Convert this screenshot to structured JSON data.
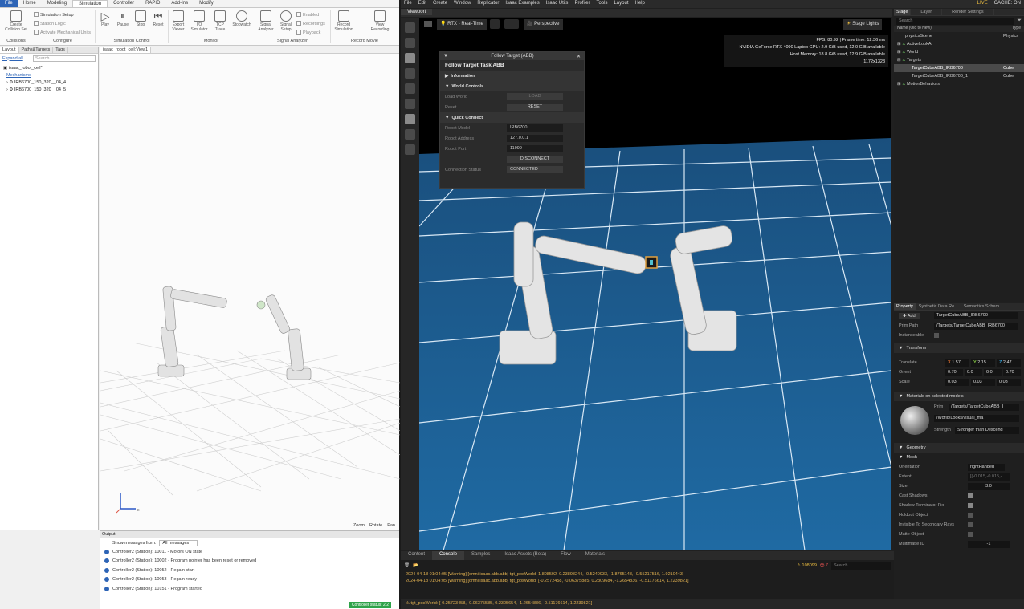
{
  "rs": {
    "menu": [
      "File",
      "Home",
      "Modeling",
      "Simulation",
      "Controller",
      "RAPID",
      "Add-Ins",
      "Modify"
    ],
    "ribbon": {
      "create_collision_set": "Create Collision Set",
      "setup_simulation": "Simulation Setup",
      "station_logic": "Station Logic",
      "activate_mech": "Activate Mechanical Units",
      "play": "Play",
      "pause": "Pause",
      "stop": "Stop",
      "reset": "Reset",
      "export_viewer": "Export Viewer",
      "io_simulator": "I/O Simulator",
      "tcp_trace": "TCP Trace",
      "stopwatch": "Stopwatch",
      "signal_analyzer": "Signal Analyzer",
      "signal_setup": "Signal Setup",
      "enabled": "Enabled",
      "recordings": "Recordings",
      "playback": "Playback",
      "record_sim": "Record Simulation",
      "view_recording": "View Recording",
      "groups": [
        "Collisions",
        "Configure",
        "Simulation Control",
        "Monitor",
        "Signal Analyzer",
        "Record Movie"
      ]
    },
    "left_tabs": [
      "Layout",
      "Paths&Targets",
      "Tags"
    ],
    "expand_all": "Expand all",
    "search_placeholder": "Search",
    "tree": {
      "station": "isaac_robot_cell*",
      "mechanisms": "Mechanisms",
      "robots": [
        "IRB6700_150_320__04_4",
        "IRB6700_150_320__04_5"
      ]
    },
    "view_tab": "isaac_robot_cell:View1",
    "view_status": [
      "Zoom",
      "Rotate",
      "Pan"
    ],
    "output": {
      "title": "Output",
      "show_label": "Show messages from:",
      "filter": "All messages",
      "messages": [
        "Controller2 (Station): 10011 - Motors ON state",
        "Controller2 (Station): 10002 - Program pointer has been reset or removed",
        "Controller2 (Station): 10052 - Regain start",
        "Controller2 (Station): 10053 - Regain ready",
        "Controller2 (Station): 10151 - Program started"
      ],
      "status": "Controller status: 2/2"
    }
  },
  "isaac": {
    "menu": [
      "File",
      "Edit",
      "Create",
      "Window",
      "Replicator",
      "Isaac Examples",
      "Isaac Utils",
      "Profiler",
      "Tools",
      "Layout",
      "Help"
    ],
    "live": "LIVE",
    "cache": "CACHE: ON",
    "viewport_tab": "Viewport",
    "render_mode": "RTX - Real-Time",
    "camera": "Perspective",
    "stage_lights": "Stage Lights",
    "stats": [
      "FPS: 80.92 | Frame time: 12.36 ms",
      "NVIDIA GeForce RTX 4090 Laptop GPU: 2.9 GiB used, 12.0 GiB available",
      "Host Memory: 18.8 GiB used, 12.9 GiB available",
      "1172x1323"
    ],
    "follow_target": {
      "title": "Follow Target (ABB)",
      "task": "Follow Target Task ABB",
      "information": "Information",
      "world_controls": "World Controls",
      "load_world": "Load World",
      "load_btn": "LOAD",
      "reset": "Reset",
      "reset_btn": "RESET",
      "quick_connect": "Quick Connect",
      "robot_model_label": "Robot Model",
      "robot_model": "IRB6700",
      "robot_address_label": "Robot Address",
      "robot_address": "127.0.0.1",
      "robot_port_label": "Robot Port",
      "robot_port": "11999",
      "disconnect_btn": "DISCONNECT",
      "connection_status_label": "Connection Status",
      "connection_status": "CONNECTED"
    },
    "stage_tabs": [
      "Stage",
      "Layer",
      "Render Settings"
    ],
    "stage_search": "Search",
    "stage_cols": [
      "Name (Old to New)",
      "Type"
    ],
    "stage_tree": [
      {
        "name": "physicsScene",
        "type": "Physics"
      },
      {
        "name": "ActiveLookAt",
        "type": ""
      },
      {
        "name": "World",
        "type": ""
      },
      {
        "name": "Targets",
        "type": ""
      },
      {
        "name": "TargetCubeABB_IRB6700",
        "type": "Cube"
      },
      {
        "name": "TargetCubeABB_IRB6700_1",
        "type": "Cube"
      },
      {
        "name": "MotionBehaviors",
        "type": ""
      }
    ],
    "prop_tabs": [
      "Property",
      "Synthetic Data Re...",
      "Semantics Schem..."
    ],
    "add": "Add",
    "prim_name": "TargetCubeABB_IRB6700",
    "prim_path_label": "Prim Path",
    "prim_path": "/Targets/TargetCubeABB_IRB6700",
    "instanceable": "Instanceable",
    "transform": "Transform",
    "translate_label": "Translate",
    "translate": [
      "1.57",
      "2.15",
      "2.47"
    ],
    "orient_label": "Orient",
    "orient": [
      "0.70",
      "0.0",
      "0.0",
      "0.70"
    ],
    "scale_label": "Scale",
    "scale": [
      "0.03",
      "0.03",
      "0.03"
    ],
    "materials_title": "Materials on selected models",
    "mat_prim_label": "Prim",
    "mat_prim": "/Targets/TargetCubeABB_I",
    "mat_path": "/World/Looks/visual_ma",
    "strength_label": "Strength",
    "strength": "Stronger than Descend",
    "geometry": "Geometry",
    "mesh": "Mesh",
    "orientation_label": "Orientation",
    "orientation": "rightHanded",
    "extent_label": "Extent",
    "extent": "[(-0.015,-0.015,-",
    "size_label": "Size",
    "size": "3.0",
    "cast_shadows": "Cast Shadows",
    "shadow_terminator": "Shadow Terminator Fix",
    "holdout": "Holdout Object",
    "invisible_secondary": "Invisible To Secondary Rays",
    "matte": "Matte Object",
    "multimatte_label": "Multimatte ID",
    "multimatte": "-1",
    "console_tabs": [
      "Content",
      "Console",
      "Samples",
      "Isaac Assets (Beta)",
      "Flow",
      "Materials"
    ],
    "console_count": "108099",
    "console_errors": "7",
    "console_search": "Search",
    "console_lines": [
      "2024-04-18 01:04:05 [Warning] [omni.isaac.abb.abb] tgt_posWorld: 1.808592, 0.23898244, -0.5240933, -1.8765148, -0.55217516, 1.9210443]",
      "2024-04-18 01:04:05 [Warning] [omni.isaac.abb.abb] tgt_posWorld: [-0.2572458, -0.06375885, 0.2309684, -1.2654836, -0.51176614, 1.2239821]"
    ],
    "status_bar": "tgt_posWorld: [-0.25723458, -0.06375585, 0.2305654, -1.2654836, -0.51176614, 1.2239821]"
  }
}
